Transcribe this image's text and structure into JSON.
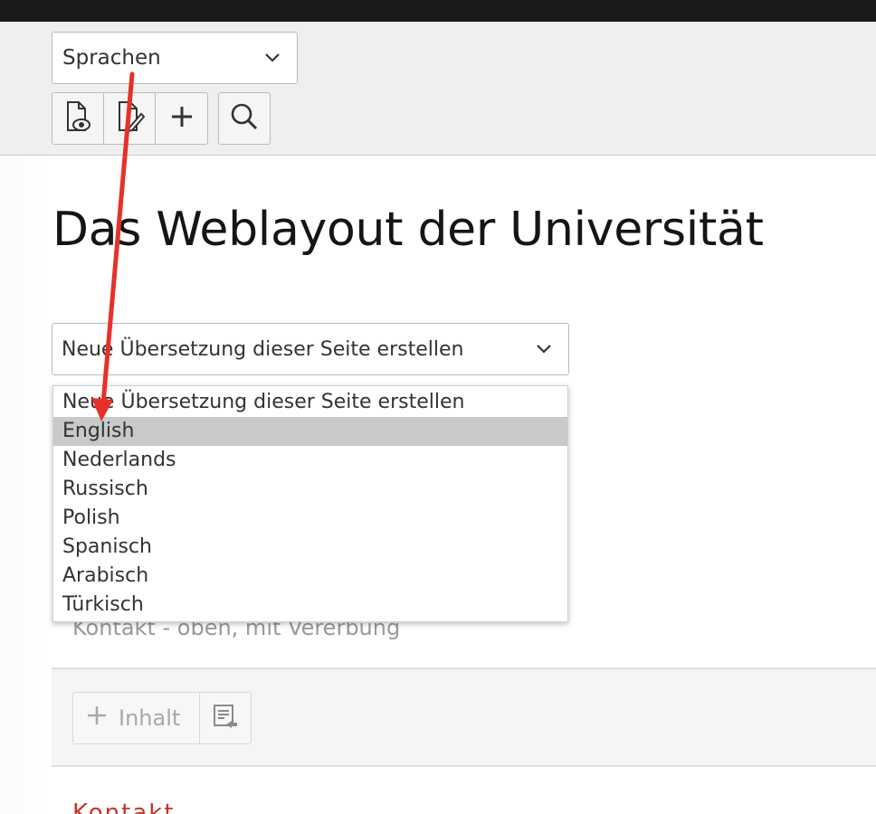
{
  "docheader": {
    "language_select": {
      "value": "Sprachen"
    },
    "buttons": [
      {
        "icon": "view-page-icon"
      },
      {
        "icon": "edit-page-icon"
      },
      {
        "icon": "plus-icon"
      }
    ],
    "search_icon": "search-icon"
  },
  "page": {
    "title": "Das Weblayout der Universität",
    "translation_select": {
      "value": "Neue Übersetzung dieser Seite erstellen",
      "options": [
        "Neue Übersetzung dieser Seite erstellen",
        "English",
        "Nederlands",
        "Russisch",
        "Polish",
        "Spanisch",
        "Arabisch",
        "Türkisch"
      ],
      "highlighted": "English"
    },
    "content_label": "Kontakt - oben, mit Vererbung",
    "add_content_label": "Inhalt",
    "cutoff_text": "Kontakt"
  },
  "colors": {
    "annotation_arrow": "#e8302a",
    "topbar": "#1a1a1a",
    "header_bg": "#efefef",
    "highlight": "#c9c9c9"
  }
}
